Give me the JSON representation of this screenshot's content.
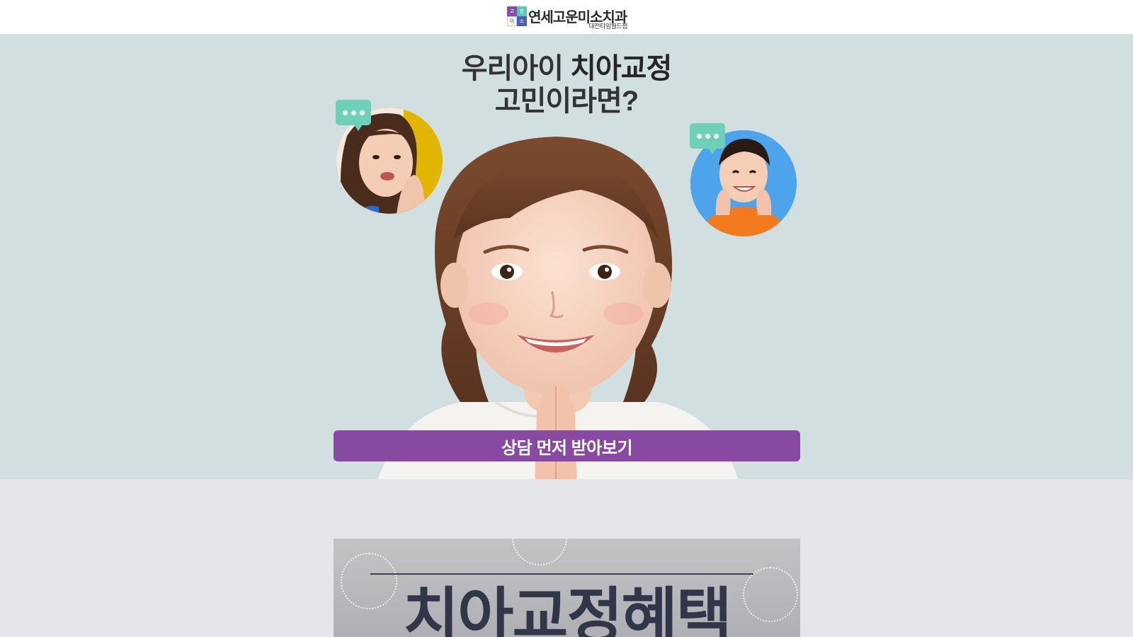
{
  "header": {
    "logo_mark": [
      "고",
      "운",
      "이",
      "소"
    ],
    "logo_name": "연세고운미소치과",
    "logo_branch": "대전타임월드점"
  },
  "hero": {
    "title_part1": "우리아이 ",
    "title_part2": "치아교정",
    "title_line2": "고민이라면?",
    "cta_label": "상담 먼저 받아보기"
  },
  "banner": {
    "title": "치아교정혜택"
  },
  "colors": {
    "hero_bg": "#d1dfe1",
    "cta": "#8849a3",
    "bubble": "#6ed0b8",
    "section_bg": "#e5e5ea"
  }
}
